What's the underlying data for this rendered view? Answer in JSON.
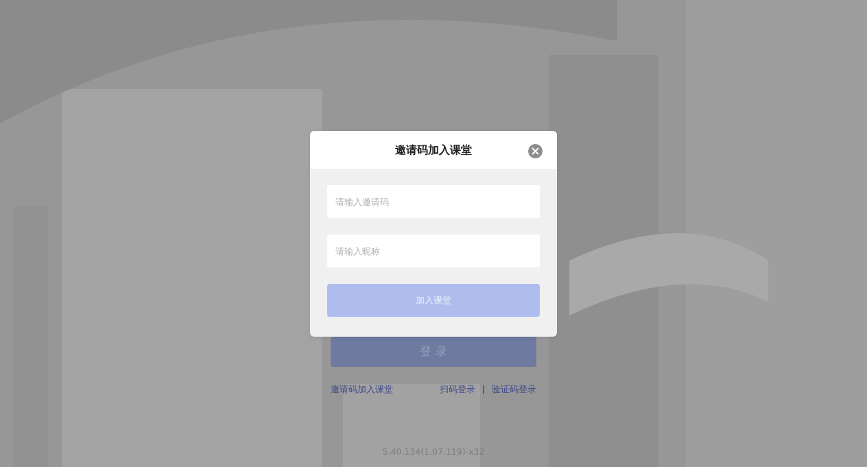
{
  "login_page": {
    "login_button": {
      "label": "登 录"
    },
    "links": {
      "invite": "邀请码加入课堂",
      "qr_login": "扫码登录",
      "separator": "|",
      "code_login": "验证码登录"
    },
    "version": "5.40.134(1.07.119)-x32"
  },
  "dialog": {
    "title": "邀请码加入课堂",
    "fields": [
      {
        "placeholder": "请输入邀请码"
      },
      {
        "placeholder": "请输入昵称"
      }
    ],
    "submit": {
      "label": "加入课堂",
      "disabled": true
    }
  }
}
